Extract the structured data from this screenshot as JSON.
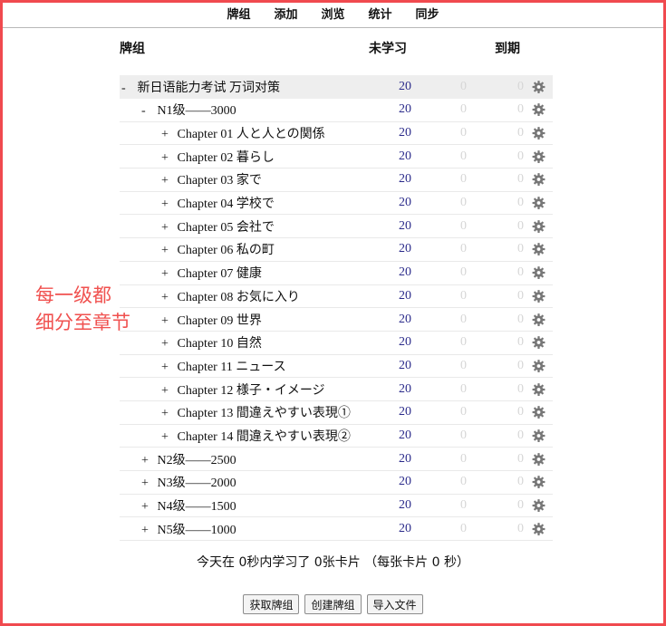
{
  "nav": [
    "牌组",
    "添加",
    "浏览",
    "统计",
    "同步"
  ],
  "table": {
    "col_deck": "牌组",
    "col_new": "未学习",
    "col_due": "到期"
  },
  "decks": [
    {
      "toggle": "-",
      "level": 0,
      "name": "新日语能力考试 万词对策",
      "new": "20",
      "learn": "0",
      "due": "0",
      "root": true
    },
    {
      "toggle": "-",
      "level": 1,
      "name": "N1级——3000",
      "new": "20",
      "learn": "0",
      "due": "0"
    },
    {
      "toggle": "+",
      "level": 2,
      "name": "Chapter 01 人と人との関係",
      "new": "20",
      "learn": "0",
      "due": "0"
    },
    {
      "toggle": "+",
      "level": 2,
      "name": "Chapter 02 暮らし",
      "new": "20",
      "learn": "0",
      "due": "0"
    },
    {
      "toggle": "+",
      "level": 2,
      "name": "Chapter 03 家で",
      "new": "20",
      "learn": "0",
      "due": "0"
    },
    {
      "toggle": "+",
      "level": 2,
      "name": "Chapter 04 学校で",
      "new": "20",
      "learn": "0",
      "due": "0"
    },
    {
      "toggle": "+",
      "level": 2,
      "name": "Chapter 05 会社で",
      "new": "20",
      "learn": "0",
      "due": "0"
    },
    {
      "toggle": "+",
      "level": 2,
      "name": "Chapter 06 私の町",
      "new": "20",
      "learn": "0",
      "due": "0"
    },
    {
      "toggle": "+",
      "level": 2,
      "name": "Chapter 07 健康",
      "new": "20",
      "learn": "0",
      "due": "0"
    },
    {
      "toggle": "+",
      "level": 2,
      "name": "Chapter 08 お気に入り",
      "new": "20",
      "learn": "0",
      "due": "0"
    },
    {
      "toggle": "+",
      "level": 2,
      "name": "Chapter 09 世界",
      "new": "20",
      "learn": "0",
      "due": "0"
    },
    {
      "toggle": "+",
      "level": 2,
      "name": "Chapter 10 自然",
      "new": "20",
      "learn": "0",
      "due": "0"
    },
    {
      "toggle": "+",
      "level": 2,
      "name": "Chapter 11 ニュース",
      "new": "20",
      "learn": "0",
      "due": "0"
    },
    {
      "toggle": "+",
      "level": 2,
      "name": "Chapter 12 様子・イメージ",
      "new": "20",
      "learn": "0",
      "due": "0"
    },
    {
      "toggle": "+",
      "level": 2,
      "name": "Chapter 13 間違えやすい表現①",
      "new": "20",
      "learn": "0",
      "due": "0"
    },
    {
      "toggle": "+",
      "level": 2,
      "name": "Chapter 14 間違えやすい表現②",
      "new": "20",
      "learn": "0",
      "due": "0"
    },
    {
      "toggle": "+",
      "level": 1,
      "name": "N2级——2500",
      "new": "20",
      "learn": "0",
      "due": "0"
    },
    {
      "toggle": "+",
      "level": 1,
      "name": "N3级——2000",
      "new": "20",
      "learn": "0",
      "due": "0"
    },
    {
      "toggle": "+",
      "level": 1,
      "name": "N4级——1500",
      "new": "20",
      "learn": "0",
      "due": "0"
    },
    {
      "toggle": "+",
      "level": 1,
      "name": "N5级——1000",
      "new": "20",
      "learn": "0",
      "due": "0"
    }
  ],
  "annotation": [
    "每一级都",
    "细分至章节"
  ],
  "summary": "今天在 0秒内学习了 0张卡片 （每张卡片 0 秒）",
  "buttons": {
    "get_shared": "获取牌组",
    "create": "创建牌组",
    "import": "导入文件"
  },
  "colors": {
    "border": "#f04a4f",
    "new_count": "#2a2a8a",
    "zero_count": "#d6d6d6",
    "annotation": "#f0514f"
  },
  "icons": {
    "options": "gear-icon"
  }
}
